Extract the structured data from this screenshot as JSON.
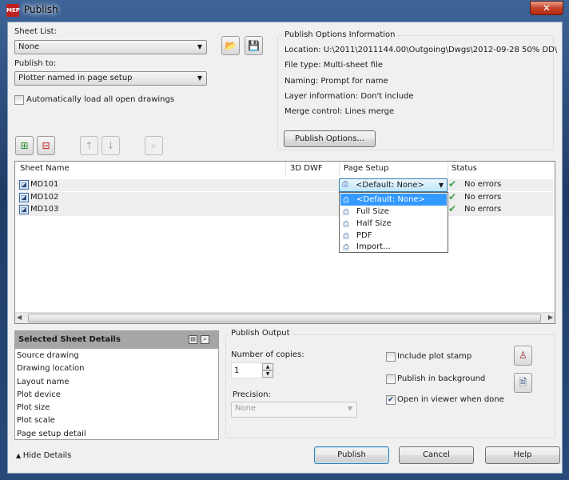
{
  "window": {
    "title": "Publish",
    "app_icon": "AutoCAD MEP",
    "close": "✕"
  },
  "sheet_list": {
    "label": "Sheet List:",
    "value": "None"
  },
  "publish_to": {
    "label": "Publish to:",
    "value": "Plotter named in page setup"
  },
  "auto_load": {
    "label": "Automatically load all open drawings",
    "checked": false
  },
  "options_info": {
    "title": "Publish Options Information",
    "lines": [
      "Location: U:\\2011\\2011144.00\\Outgoing\\Dwgs\\2012-09-28 50% DD\\",
      "File type: Multi-sheet file",
      "Naming: Prompt for name",
      "Layer information: Don't include",
      "Merge control: Lines merge"
    ],
    "button": "Publish Options..."
  },
  "sheet_table": {
    "headers": [
      "Sheet Name",
      "3D DWF",
      "Page Setup",
      "Status"
    ],
    "rows": [
      {
        "name": "MD101",
        "page_setup": "<Default: None>",
        "status": "No errors"
      },
      {
        "name": "MD102",
        "status": "No errors"
      },
      {
        "name": "MD103",
        "status": "No errors"
      }
    ]
  },
  "page_setup_dropdown": {
    "options": [
      "<Default: None>",
      "Full Size",
      "Half Size",
      "PDF",
      "Import..."
    ],
    "selected": "<Default: None>"
  },
  "details": {
    "title": "Selected Sheet Details",
    "items": [
      "Source drawing",
      "Drawing location",
      "Layout name",
      "Plot device",
      "Plot size",
      "Plot scale",
      "Page setup detail"
    ]
  },
  "output": {
    "title": "Publish Output",
    "copies_label": "Number of copies:",
    "copies": "1",
    "precision_label": "Precision:",
    "precision": "None",
    "include_stamp": {
      "label": "Include plot stamp",
      "checked": false
    },
    "background": {
      "label": "Publish in background",
      "checked": false
    },
    "open_viewer": {
      "label": "Open in viewer when done",
      "checked": true
    }
  },
  "footer": {
    "hide_details": "Hide Details",
    "publish": "Publish",
    "cancel": "Cancel",
    "help": "Help"
  }
}
